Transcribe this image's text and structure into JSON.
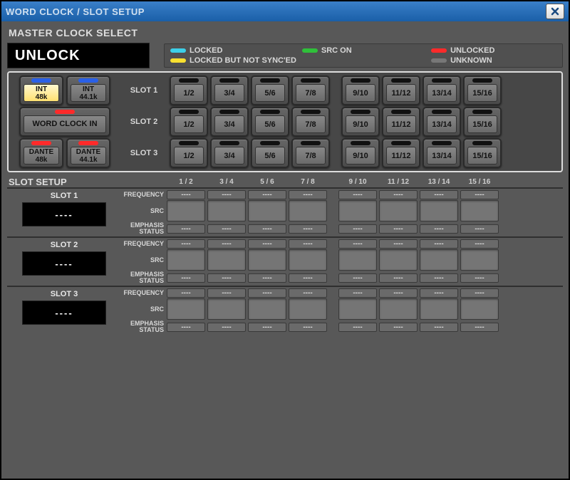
{
  "title": "WORD CLOCK / SLOT SETUP",
  "master_clock_title": "MASTER CLOCK SELECT",
  "lock_status": "UNLOCK",
  "legend": {
    "locked": {
      "label": "LOCKED",
      "color": "#3dd0e8"
    },
    "src_on": {
      "label": "SRC ON",
      "color": "#2fc03a"
    },
    "unlocked": {
      "label": "UNLOCKED",
      "color": "#ff2a2a"
    },
    "locked_not_synced": {
      "label": "LOCKED BUT NOT SYNC'ED",
      "color": "#f8e030"
    },
    "unknown": {
      "label": "UNKNOWN",
      "color": "#777777"
    }
  },
  "clock_sources": {
    "int_48k": {
      "line1": "INT",
      "line2": "48k",
      "indicator": "#2a60e8",
      "active": true
    },
    "int_441k": {
      "line1": "INT",
      "line2": "44.1k",
      "indicator": "#2a60e8",
      "active": false
    },
    "word_clock_in": {
      "label": "WORD CLOCK IN",
      "indicator": "#ff2a2a",
      "active": false
    },
    "dante_48k": {
      "line1": "DANTE",
      "line2": "48k",
      "indicator": "#ff2a2a",
      "active": false
    },
    "dante_441k": {
      "line1": "DANTE",
      "line2": "44.1k",
      "indicator": "#ff2a2a",
      "active": false
    }
  },
  "slot_labels": [
    "SLOT 1",
    "SLOT 2",
    "SLOT 3"
  ],
  "channels": [
    "1/2",
    "3/4",
    "5/6",
    "7/8",
    "9/10",
    "11/12",
    "13/14",
    "15/16"
  ],
  "slot_setup_title": "SLOT SETUP",
  "channel_headers": [
    "1 / 2",
    "3 / 4",
    "5 / 6",
    "7 / 8",
    "9 / 10",
    "11 / 12",
    "13 / 14",
    "15 / 16"
  ],
  "param_labels": {
    "frequency": "FREQUENCY",
    "src": "SRC",
    "emphasis": "EMPHASIS\nSTATUS"
  },
  "slots": [
    {
      "name": "SLOT 1",
      "display": "----",
      "frequency": [
        "----",
        "----",
        "----",
        "----",
        "----",
        "----",
        "----",
        "----"
      ],
      "src": [
        "",
        "",
        "",
        "",
        "",
        "",
        "",
        ""
      ],
      "emphasis": [
        "----",
        "----",
        "----",
        "----",
        "----",
        "----",
        "----",
        "----"
      ]
    },
    {
      "name": "SLOT 2",
      "display": "----",
      "frequency": [
        "----",
        "----",
        "----",
        "----",
        "----",
        "----",
        "----",
        "----"
      ],
      "src": [
        "",
        "",
        "",
        "",
        "",
        "",
        "",
        ""
      ],
      "emphasis": [
        "----",
        "----",
        "----",
        "----",
        "----",
        "----",
        "----",
        "----"
      ]
    },
    {
      "name": "SLOT 3",
      "display": "----",
      "frequency": [
        "----",
        "----",
        "----",
        "----",
        "----",
        "----",
        "----",
        "----"
      ],
      "src": [
        "",
        "",
        "",
        "",
        "",
        "",
        "",
        ""
      ],
      "emphasis": [
        "----",
        "----",
        "----",
        "----",
        "----",
        "----",
        "----",
        "----"
      ]
    }
  ]
}
